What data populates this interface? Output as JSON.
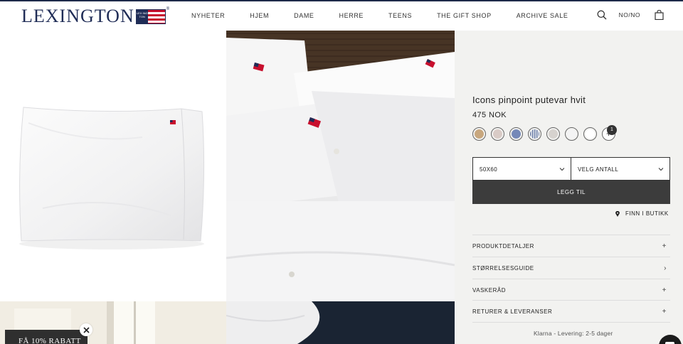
{
  "header": {
    "logo": "LEXINGTON",
    "logo_flag_text": "LEX ING TON",
    "nav": [
      "NYHETER",
      "HJEM",
      "DAME",
      "HERRE",
      "TEENS",
      "THE GIFT SHOP",
      "ARCHIVE SALE"
    ],
    "locale": "NO/NO",
    "icons": [
      "search-icon",
      "bag-icon"
    ]
  },
  "promo": {
    "label": "FÅ 10% RABATT",
    "close_icon": "close-icon"
  },
  "product": {
    "title": "Icons pinpoint putevar hvit",
    "price": "475 NOK",
    "swatches": [
      "#c8a77e",
      "#d9cbc6",
      "#7488b8",
      "stripe",
      "#d6d2ce",
      "#f4f4f4",
      "#ffffff"
    ],
    "more_swatches_badge": "1",
    "more_swatches_symbol": "+",
    "size_select": "50X60",
    "qty_select": "VELG ANTALL",
    "add_button": "LEGG TIL",
    "store_link": "FINN I BUTIKK",
    "accordions": [
      {
        "label": "PRODUKTDETALJER",
        "symbol": "+"
      },
      {
        "label": "STØRRELSESGUIDE",
        "symbol": "›"
      },
      {
        "label": "VASKERÅD",
        "symbol": "+"
      },
      {
        "label": "RETURER & LEVERANSER",
        "symbol": "+"
      }
    ],
    "delivery": "Klarna - Levering: 2-5 dager"
  },
  "colors": {
    "brand": "#1f2c56",
    "button": "#3c3c3c",
    "panel_bg": "#f2f2f0"
  }
}
